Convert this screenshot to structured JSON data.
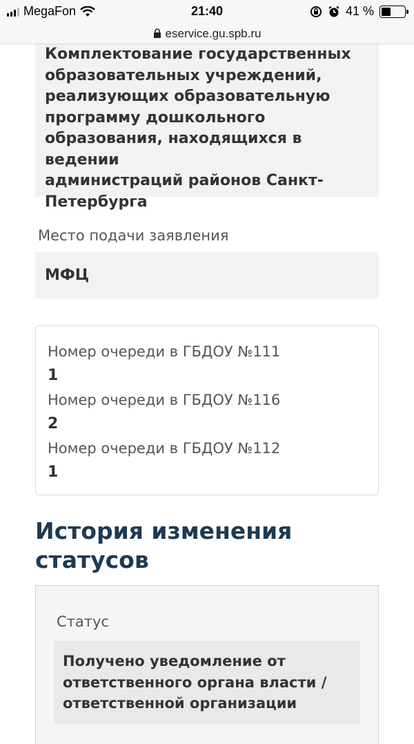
{
  "status_bar": {
    "carrier": "MegaFon",
    "time": "21:40",
    "battery": "41 %",
    "battery_level": 0.41,
    "wifi_icon": "wifi-icon",
    "lock_rotation_icon": "rotation-lock-icon",
    "alarm_icon": "alarm-icon"
  },
  "url_bar": {
    "url": "eservice.gu.spb.ru",
    "lock_icon": "padlock-icon"
  },
  "service": {
    "lines": [
      "Комплектование государственных",
      "образовательных учреждений,",
      "реализующих образовательную",
      "программу дошкольного",
      "образования, находящихся в ведении",
      "администраций районов Санкт-",
      "Петербурга"
    ]
  },
  "place": {
    "label": "Место подачи заявления",
    "value": "МФЦ"
  },
  "queues": [
    {
      "title": "Номер очереди в ГБДОУ №111",
      "number": "1"
    },
    {
      "title": "Номер очереди в ГБДОУ №116",
      "number": "2"
    },
    {
      "title": "Номер очереди в ГБДОУ №112",
      "number": "1"
    }
  ],
  "history": {
    "title_line1": "История изменения",
    "title_line2": "статусов",
    "status_label": "Статус",
    "status_lines": [
      "Получено уведомление от",
      "ответственного органа власти /",
      "ответственной организации"
    ]
  }
}
